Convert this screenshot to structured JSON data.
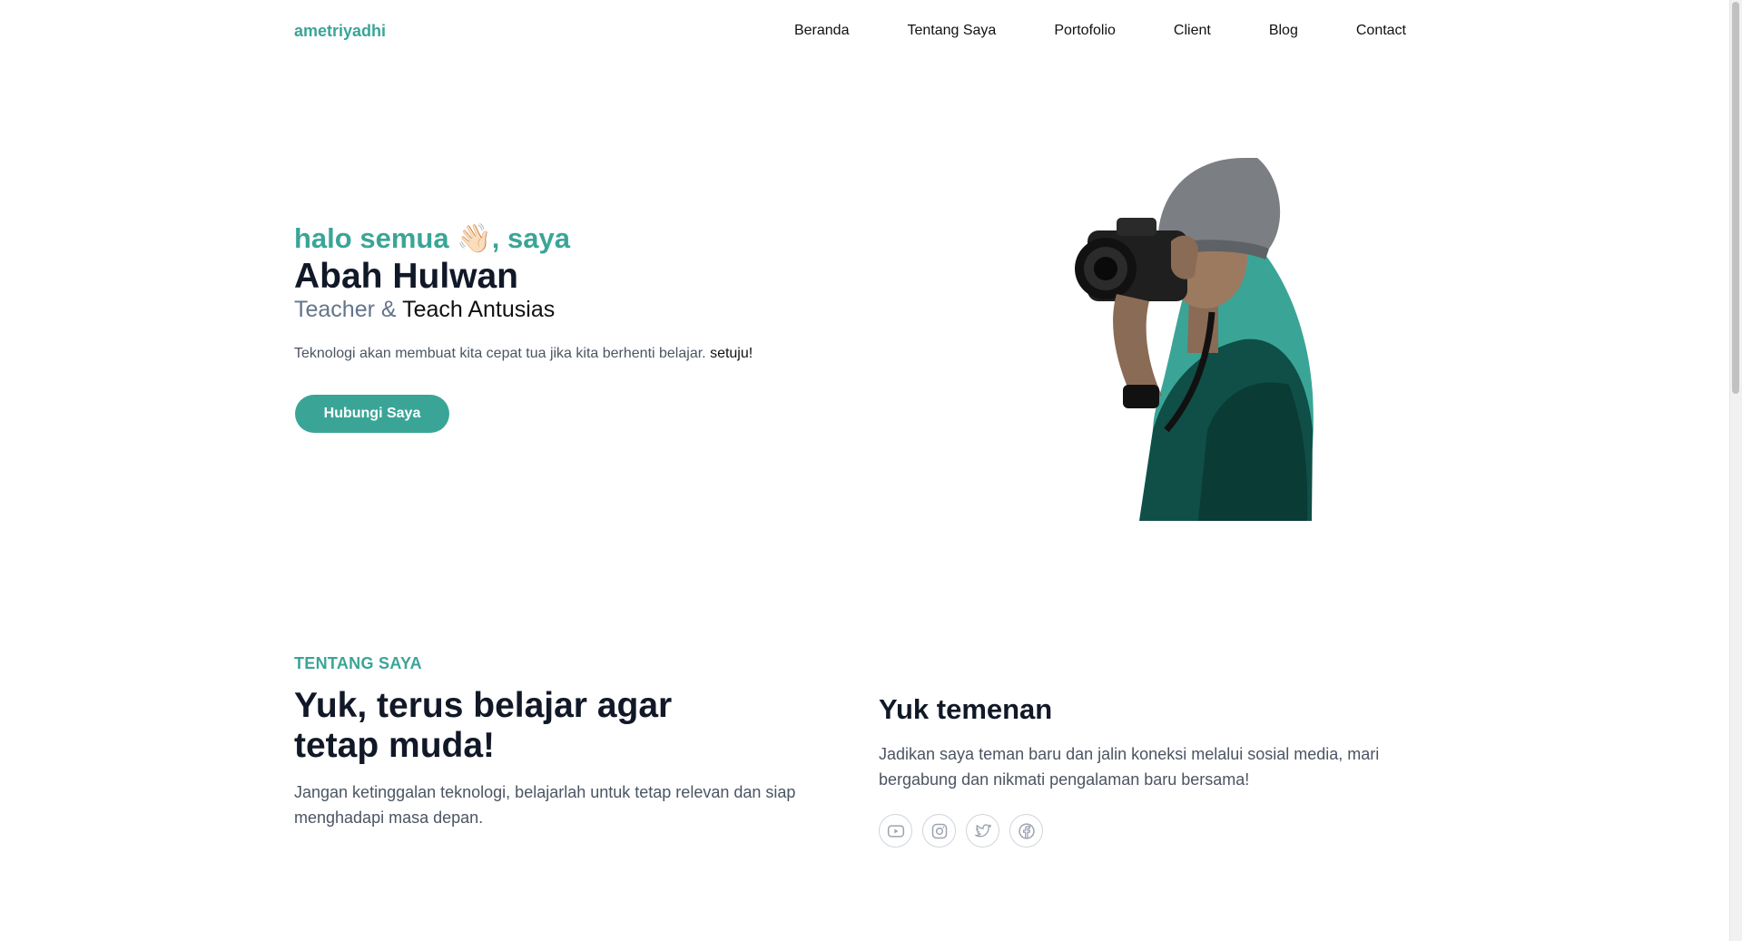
{
  "nav": {
    "brand": "ametriyadhi",
    "links": [
      {
        "label": "Beranda"
      },
      {
        "label": "Tentang Saya"
      },
      {
        "label": "Portofolio"
      },
      {
        "label": "Client"
      },
      {
        "label": "Blog"
      },
      {
        "label": "Contact"
      }
    ]
  },
  "hero": {
    "greeting": "halo semua 👋🏻, saya",
    "name": "Abah Hulwan",
    "role_prefix": "Teacher &",
    "role_suffix": "Teach Antusias",
    "description": "Teknologi akan membuat kita cepat tua jika kita berhenti belajar.",
    "description_emphasis": "setuju!",
    "cta_label": "Hubungi Saya",
    "photo_accent": "#3aa597"
  },
  "about": {
    "eyebrow": "TENTANG SAYA",
    "heading": "Yuk, terus belajar agar tetap muda!",
    "text": "Jangan ketinggalan teknologi, belajarlah untuk tetap relevan dan siap menghadapi masa depan."
  },
  "friends": {
    "heading": "Yuk temenan",
    "text": "Jadikan saya teman baru dan jalin koneksi melalui sosial media, mari bergabung dan nikmati pengalaman baru bersama!",
    "socials": [
      {
        "icon": "youtube-icon"
      },
      {
        "icon": "instagram-icon"
      },
      {
        "icon": "twitter-icon"
      },
      {
        "icon": "facebook-icon"
      }
    ]
  },
  "colors": {
    "accent": "#3aa597",
    "heading": "#111827",
    "body": "#4b5563"
  }
}
